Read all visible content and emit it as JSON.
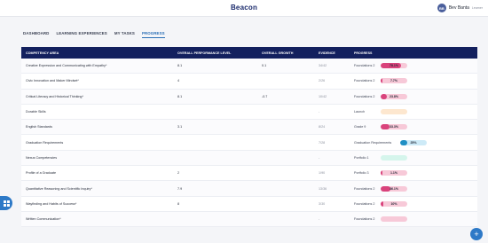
{
  "app": {
    "title": "Beacon"
  },
  "user": {
    "initials": "BB",
    "name": "Bev Banta",
    "role": "Learner"
  },
  "tabs": [
    "DASHBOARD",
    "LEARNING EXPERIENCES",
    "MY TASKS",
    "PROGRESS"
  ],
  "active_tab": "PROGRESS",
  "table": {
    "headers": [
      "COMPETENCY AREA",
      "OVERALL PERFORMANCE LEVEL",
      "OVERALL GROWTH",
      "EVIDENCE",
      "PROGRESS"
    ],
    "rows": [
      {
        "area": "Creative Expression and Communicating with Empathy*",
        "level": "8.1",
        "growth": "0.1",
        "evidence": "34/42",
        "plabel": "Foundations 2",
        "pct": "78.1%",
        "fill": 0.78,
        "bar": "#f7c9d8",
        "color": "#d9437c"
      },
      {
        "area": "Civic Innovation and Maker Mindset*",
        "level": "4",
        "growth": "",
        "evidence": "2/26",
        "plabel": "Foundations 2",
        "pct": "7.7%",
        "fill": 0.077,
        "bar": "#f7c9d8",
        "color": "#d9437c"
      },
      {
        "area": "Critical Literacy and Historical Thinking*",
        "level": "8.1",
        "growth": "-0.7",
        "evidence": "10/42",
        "plabel": "Foundations 2",
        "pct": "23.8%",
        "fill": 0.238,
        "bar": "#f7c9d8",
        "color": "#d9437c"
      },
      {
        "area": "Durable Skills",
        "level": "",
        "growth": "",
        "evidence": "-",
        "plabel": "Launch",
        "pct": "",
        "fill": 0,
        "bar": "#fde7cf",
        "color": "#f0a35a"
      },
      {
        "area": "English Standards",
        "level": "3.1",
        "growth": "",
        "evidence": "8/24",
        "plabel": "Grade 9",
        "pct": "33.3%",
        "fill": 0.333,
        "bar": "#f7c9d8",
        "color": "#d9437c"
      },
      {
        "area": "Graduation Requirements",
        "level": "",
        "growth": "",
        "evidence": "7/28",
        "plabel": "Graduation Requirements",
        "pct": "25%",
        "fill": 0.25,
        "bar": "#cdeaf7",
        "color": "#1f8fc4"
      },
      {
        "area": "Nexus Competencies",
        "level": "",
        "growth": "",
        "evidence": "-",
        "plabel": "Portfolio 1",
        "pct": "",
        "fill": 0,
        "bar": "#d5f5ec",
        "color": "#3cc39b"
      },
      {
        "area": "Profile of a Graduate",
        "level": "2",
        "growth": "",
        "evidence": "1/90",
        "plabel": "Portfolio 3",
        "pct": "1.1%",
        "fill": 0.011,
        "bar": "#f7c9d8",
        "color": "#d9437c"
      },
      {
        "area": "Quantitative Reasoning and Scientific Inquiry*",
        "level": "7.9",
        "growth": "",
        "evidence": "13/36",
        "plabel": "Foundations 2",
        "pct": "36.1%",
        "fill": 0.361,
        "bar": "#f7c9d8",
        "color": "#d9437c"
      },
      {
        "area": "Wayfinding and Habits of Success*",
        "level": "8",
        "growth": "",
        "evidence": "3/30",
        "plabel": "Foundations 2",
        "pct": "10%",
        "fill": 0.1,
        "bar": "#f7c9d8",
        "color": "#d9437c"
      },
      {
        "area": "Written Communication*",
        "level": "",
        "growth": "",
        "evidence": "-",
        "plabel": "Foundations 2",
        "pct": "",
        "fill": 0,
        "bar": "#f7c9d8",
        "color": "#d9437c"
      }
    ]
  },
  "icons": {
    "left_button": "grid-icon",
    "fab": "plus-icon"
  },
  "fab_label": "+"
}
